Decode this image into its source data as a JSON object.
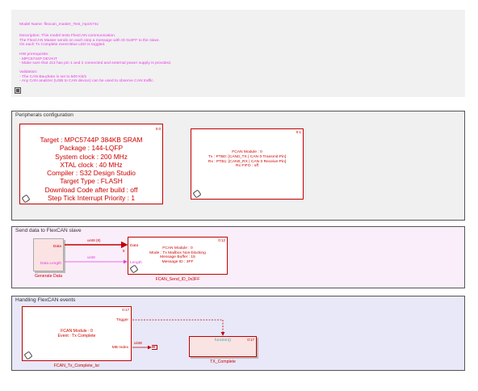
{
  "description": {
    "model_name": "Model Name: flexcan_master_Test_mpc574x",
    "desc_lines": [
      "Description: This model tests FlexCAN communication.",
      "The FlexCAN Master sends on each step a message with ID 0x3FF to the slave.",
      "On each Tx Complete event Blue LED is toggled."
    ],
    "hw_lines": [
      "HW prerequisite:",
      "- MPC5744P DEVKIT",
      "- Make sure that J13 has pin 1 and 2 connected and external power supply is provided."
    ],
    "validation_lines": [
      "Validation:",
      "- The CAN Baudrate is set to 500 Kb/s",
      "- Any CAN analizer (USB to CAN device) can be used to observe CAN traffic."
    ]
  },
  "areas": {
    "peripherals": {
      "title": "Peripherals configuration"
    },
    "send": {
      "title": "Send data to FlexCAN slave"
    },
    "handling": {
      "title": "Handling FlexCAN events"
    }
  },
  "blocks": {
    "target_config": {
      "mark": "0:0",
      "lines": [
        "Target : MPC5744P 384KB SRAM",
        "Package : 144-LQFP",
        "System clock : 200 MHz",
        "XTAL clock : 40 MHz",
        "Compiler : S32 Design Studio",
        "Target Type : FLASH",
        "Download Code after build : off",
        "Step Tick Interrupt Priority : 1"
      ]
    },
    "fcan_config": {
      "mark": "0:1",
      "lines": [
        "FCAN Module : 0",
        "Tx : PTB0: [CAN0_TX | CAN 0 Transmit Pin]",
        "Rx : PTB1: [CAN0_RX | CAN 0 Receive Pin]",
        "Rx FIFO : off"
      ]
    },
    "generate_data": {
      "port_data": "Data",
      "port_length": "Data Length",
      "caption": "Generate Data"
    },
    "fcan_send": {
      "mark": "0:12",
      "port_data": "Data",
      "port_length": "Length",
      "lines": [
        "FCAN Module : 0",
        "Mode : Tx Mailbox Non-blocking",
        "Message Buffer : 15",
        "Message ID : 3FF"
      ],
      "caption": "FCAN_Send_ID_0x3FF"
    },
    "fcan_tx_complete": {
      "mark": "0:17",
      "lines": [
        "FCAN Module : 0",
        "Event : Tx Complete"
      ],
      "port_trigger": "Trigger",
      "port_mb_index": "MB Index",
      "caption": "FCAN_Tx_Complete_Isr"
    },
    "tx_complete": {
      "mark": "0:17",
      "function_label": "function()",
      "caption": "TX_Complete"
    }
  },
  "signals": {
    "data_type": "uint8 (8)",
    "data_width": "8",
    "length_type": "uint8",
    "mb_type": "uint8"
  }
}
